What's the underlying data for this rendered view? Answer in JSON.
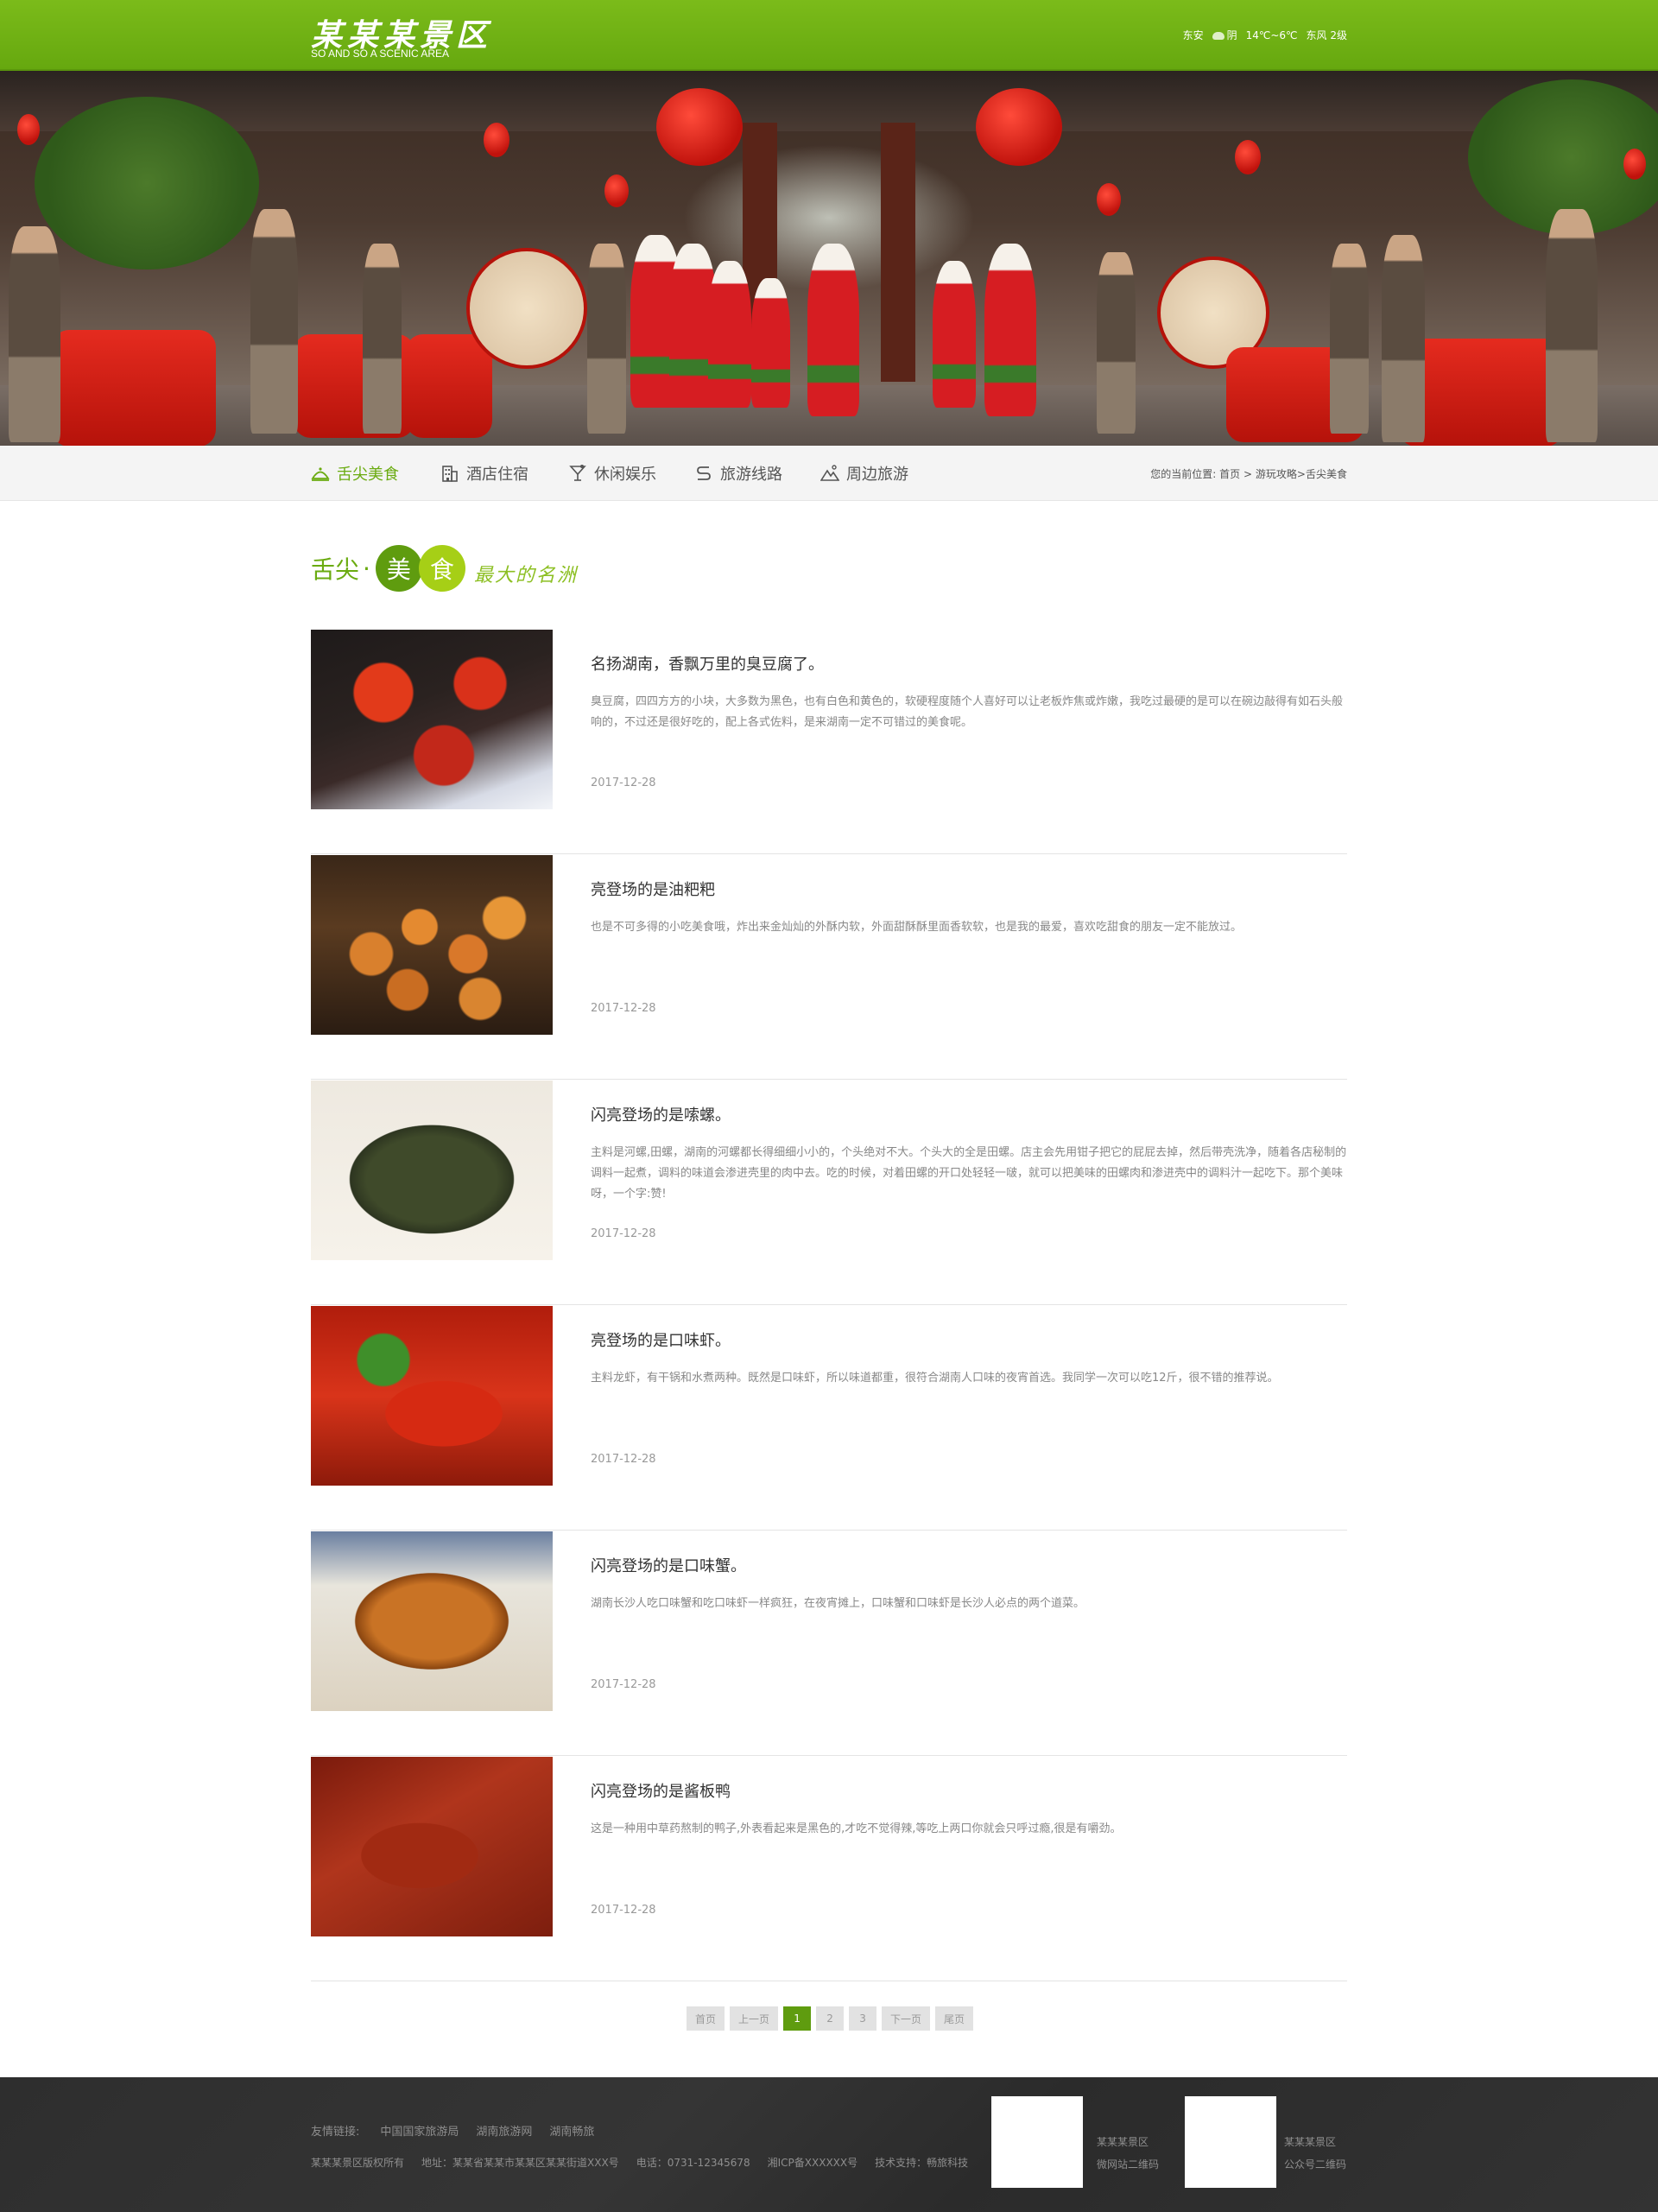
{
  "header": {
    "logo_cn": "某某某景区",
    "logo_en": "SO AND SO A SCENIC AREA",
    "weather": {
      "city": "东安",
      "condition": "阴",
      "temp": "14℃~6℃",
      "wind": "东风 2级",
      "icon": "cloud-icon"
    }
  },
  "nav": {
    "items": [
      {
        "label": "舌尖美食",
        "icon": "food-icon",
        "active": true
      },
      {
        "label": "酒店住宿",
        "icon": "hotel-icon",
        "active": false
      },
      {
        "label": "休闲娱乐",
        "icon": "cocktail-icon",
        "active": false
      },
      {
        "label": "旅游线路",
        "icon": "route-icon",
        "active": false
      },
      {
        "label": "周边旅游",
        "icon": "mountain-icon",
        "active": false
      }
    ],
    "breadcrumb": {
      "prefix": "您的当前位置:",
      "home": "首页",
      "sep1": ">",
      "section": "游玩攻略",
      "sep2": ">",
      "current": "舌尖美食"
    }
  },
  "section": {
    "title_prefix": "舌尖",
    "dot": "·",
    "circle1": "美",
    "circle2": "食",
    "slogan": "最大的名洲"
  },
  "articles": [
    {
      "title": "名扬湖南，香飘万里的臭豆腐了。",
      "desc": "臭豆腐，四四方方的小块，大多数为黑色，也有白色和黄色的，软硬程度随个人喜好可以让老板炸焦或炸嫩，我吃过最硬的是可以在碗边敲得有如石头般响的，不过还是很好吃的，配上各式佐料，是来湖南一定不可错过的美食呢。",
      "date": "2017-12-28",
      "image": "food1"
    },
    {
      "title": "亮登场的是油粑粑",
      "desc": "也是不可多得的小吃美食哦，炸出来金灿灿的外酥内软，外面甜酥酥里面香软软，也是我的最爱，喜欢吃甜食的朋友一定不能放过。",
      "date": "2017-12-28",
      "image": "food2"
    },
    {
      "title": "闪亮登场的是嗦螺。",
      "desc": "主料是河螺,田螺，湖南的河螺都长得细细小小的，个头绝对不大。个头大的全是田螺。店主会先用钳子把它的屁屁去掉，然后带壳洗净，随着各店秘制的调料一起煮，调料的味道会渗进壳里的肉中去。吃的时候，对着田螺的开口处轻轻一啵，就可以把美味的田螺肉和渗进壳中的调料汁一起吃下。那个美味呀，一个字:赞!",
      "date": "2017-12-28",
      "image": "food3"
    },
    {
      "title": "亮登场的是口味虾。",
      "desc": "主料龙虾，有干锅和水煮两种。既然是口味虾，所以味道都重，很符合湖南人口味的夜宵首选。我同学一次可以吃12斤，很不错的推荐说。",
      "date": "2017-12-28",
      "image": "food4"
    },
    {
      "title": "闪亮登场的是口味蟹。",
      "desc": "湖南长沙人吃口味蟹和吃口味虾一样疯狂，在夜宵摊上，口味蟹和口味虾是长沙人必点的两个道菜。",
      "date": "2017-12-28",
      "image": "food5"
    },
    {
      "title": "闪亮登场的是酱板鸭",
      "desc": "这是一种用中草药熬制的鸭子,外表看起来是黑色的,才吃不觉得辣,等吃上两口你就会只呼过瘾,很是有嚼劲。",
      "date": "2017-12-28",
      "image": "food6"
    }
  ],
  "pagination": {
    "first": "首页",
    "prev": "上一页",
    "pages": [
      "1",
      "2",
      "3"
    ],
    "current": "1",
    "next": "下一页",
    "last": "尾页"
  },
  "footer": {
    "links_label": "友情链接:",
    "links": [
      "中国国家旅游局",
      "湖南旅游网",
      "湖南畅旅"
    ],
    "copyright": "某某某景区版权所有",
    "address": "地址：某某省某某市某某区某某街道XXX号",
    "phone": "电话：0731-12345678",
    "icp": "湘ICP备XXXXXX号",
    "support": "技术支持：畅旅科技",
    "qr1": {
      "name": "某某某景区",
      "label": "微网站二维码"
    },
    "qr2": {
      "name": "某某某景区",
      "label": "公众号二维码"
    }
  },
  "colors": {
    "brand_green": "#6aab10",
    "header_green": "#72b314",
    "circle_dark": "#5f9c0f",
    "circle_light": "#a6cf16",
    "footer_bg": "#2f2f2f"
  }
}
